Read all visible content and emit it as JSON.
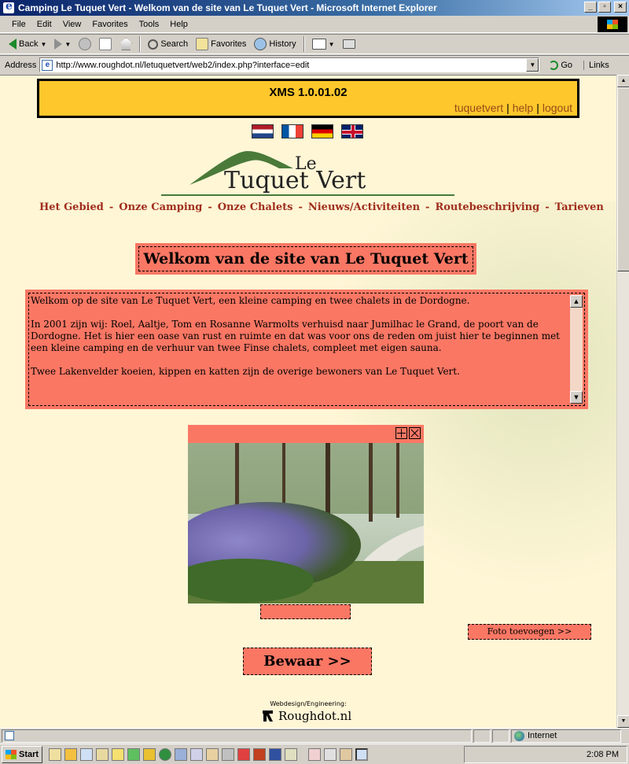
{
  "window": {
    "title": "Camping Le Tuquet Vert - Welkom van de site van Le Tuquet Vert - Microsoft Internet Explorer",
    "buttons": {
      "minimize": "_",
      "maximize": "▫",
      "close": "×"
    }
  },
  "menu": [
    "File",
    "Edit",
    "View",
    "Favorites",
    "Tools",
    "Help"
  ],
  "toolbar": {
    "back": "Back",
    "search": "Search",
    "favorites": "Favorites",
    "history": "History"
  },
  "address": {
    "label": "Address",
    "url": "http://www.roughdot.nl/letuquetvert/web2/index.php?interface=edit",
    "go": "Go",
    "links": "Links"
  },
  "xms": {
    "title": "XMS 1.0.01.02",
    "links": [
      "tuquetvert",
      "help",
      "logout"
    ]
  },
  "flags": [
    {
      "name": "flag-netherlands"
    },
    {
      "name": "flag-france"
    },
    {
      "name": "flag-germany"
    },
    {
      "name": "flag-uk"
    }
  ],
  "logo": {
    "line1": "Le",
    "line2": "Tuquet Vert"
  },
  "nav": [
    "Het Gebied",
    "Onze Camping",
    "Onze Chalets",
    "Nieuws/Activiteiten",
    "Routebeschrijving",
    "Tarieven"
  ],
  "nav_separator": "-",
  "heading": "Welkom van de site van Le Tuquet Vert",
  "body_paragraphs": [
    "Welkom op de site van Le Tuquet Vert, een kleine camping en twee chalets in de Dordogne.",
    "In 2001 zijn wij: Roel, Aaltje, Tom en Rosanne Warmolts verhuisd naar Jumilhac le Grand, de poort van de Dordogne. Het is hier een oase van rust en ruimte en dat was voor ons de reden om juist hier te beginnen met een kleine camping en de verhuur van twee Finse chalets, compleet met eigen sauna.",
    "Twee Lakenvelder koeien, kippen en katten zijn de overige bewoners van Le Tuquet Vert."
  ],
  "photo": {
    "tools": [
      "add-icon",
      "delete-icon"
    ]
  },
  "add_photo": "Foto toevoegen >>",
  "save": "Bewaar >>",
  "footer": {
    "label": "Webdesign/Engineering:",
    "brand": "Roughdot.nl"
  },
  "status": {
    "zone": "Internet"
  },
  "taskbar": {
    "start": "Start",
    "time": "2:08 PM"
  },
  "colors": {
    "page_bg": "#fff6d6",
    "xms_bg": "#fec72c",
    "edit_box_bg": "#fa7764",
    "nav_text": "#a02e1c"
  }
}
